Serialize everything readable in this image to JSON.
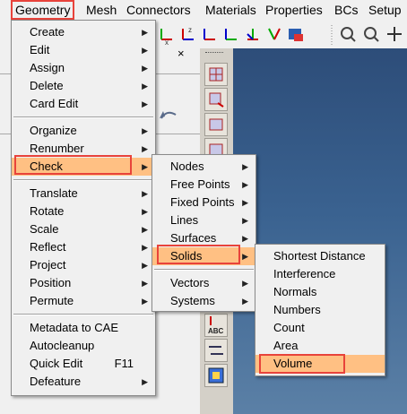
{
  "menubar": {
    "items": [
      "Geometry",
      "Mesh",
      "Connectors",
      "Materials",
      "Properties",
      "BCs",
      "Setup"
    ]
  },
  "toolbar": {
    "icons": [
      "x-axis-icon",
      "z-axis-icon",
      "y-axis-icon",
      "axis-left-icon",
      "axis-iso-icon",
      "axis-flip-icon",
      "shaded-view-icon",
      "zoom-box-icon",
      "zoom-fit-icon",
      "rotate-icon"
    ]
  },
  "geometry_menu": {
    "groups": [
      [
        {
          "label": "Create",
          "submenu": true
        },
        {
          "label": "Edit",
          "submenu": true
        },
        {
          "label": "Assign",
          "submenu": true
        },
        {
          "label": "Delete",
          "submenu": true
        },
        {
          "label": "Card Edit",
          "submenu": true
        }
      ],
      [
        {
          "label": "Organize",
          "submenu": true
        },
        {
          "label": "Renumber",
          "submenu": true
        },
        {
          "label": "Check",
          "submenu": true,
          "selected": true
        }
      ],
      [
        {
          "label": "Translate",
          "submenu": true
        },
        {
          "label": "Rotate",
          "submenu": true
        },
        {
          "label": "Scale",
          "submenu": true
        },
        {
          "label": "Reflect",
          "submenu": true
        },
        {
          "label": "Project",
          "submenu": true
        },
        {
          "label": "Position",
          "submenu": true
        },
        {
          "label": "Permute",
          "submenu": true
        }
      ],
      [
        {
          "label": "Metadata to CAE",
          "submenu": false
        },
        {
          "label": "Autocleanup",
          "submenu": false
        },
        {
          "label": "Quick Edit",
          "submenu": false,
          "shortcut": "F11"
        },
        {
          "label": "Defeature",
          "submenu": true
        }
      ]
    ]
  },
  "check_menu": {
    "groups": [
      [
        {
          "label": "Nodes",
          "submenu": true
        },
        {
          "label": "Free Points",
          "submenu": true
        },
        {
          "label": "Fixed Points",
          "submenu": true
        },
        {
          "label": "Lines",
          "submenu": true
        },
        {
          "label": "Surfaces",
          "submenu": true
        },
        {
          "label": "Solids",
          "submenu": true,
          "selected": true
        }
      ],
      [
        {
          "label": "Vectors",
          "submenu": true
        },
        {
          "label": "Systems",
          "submenu": true
        }
      ]
    ]
  },
  "solids_menu": {
    "items": [
      {
        "label": "Shortest Distance"
      },
      {
        "label": "Interference"
      },
      {
        "label": "Normals"
      },
      {
        "label": "Numbers"
      },
      {
        "label": "Count"
      },
      {
        "label": "Area"
      },
      {
        "label": "Volume",
        "selected": true
      }
    ]
  },
  "panel": {
    "close_glyph": "×"
  },
  "colors": {
    "highlight": "#ffc083",
    "annotation_red": "#e8433b",
    "viewport_top": "#2d4d79",
    "viewport_bottom": "#5b80a6"
  }
}
